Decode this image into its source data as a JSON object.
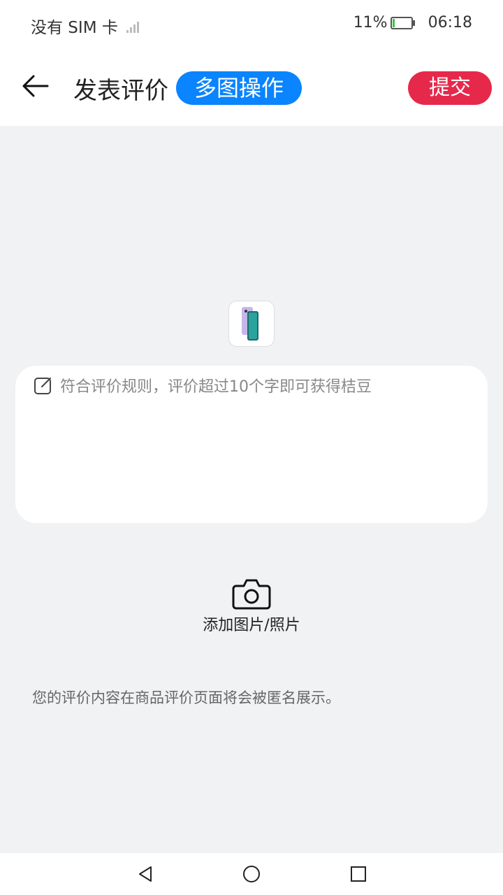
{
  "status_bar": {
    "carrier": "没有 SIM 卡",
    "battery": "11%",
    "battery_level": 0.11,
    "time": "06:18"
  },
  "header": {
    "title": "发表评价",
    "multi_image_label": "多图操作",
    "submit_label": "提交"
  },
  "review": {
    "placeholder": "符合评价规则，评价超过10个字即可获得桔豆",
    "value": ""
  },
  "add_photo": {
    "label": "添加图片/照片"
  },
  "note": "您的评价内容在商品评价页面将会被匿名展示。",
  "colors": {
    "accent_blue": "#0a84ff",
    "submit_red": "#e6294b",
    "background": "#f1f2f4"
  },
  "icons": {
    "back": "arrow-left-icon",
    "edit": "edit-icon",
    "camera": "camera-icon",
    "nav_back": "triangle-back-icon",
    "nav_home": "circle-home-icon",
    "nav_recent": "square-recent-icon"
  }
}
